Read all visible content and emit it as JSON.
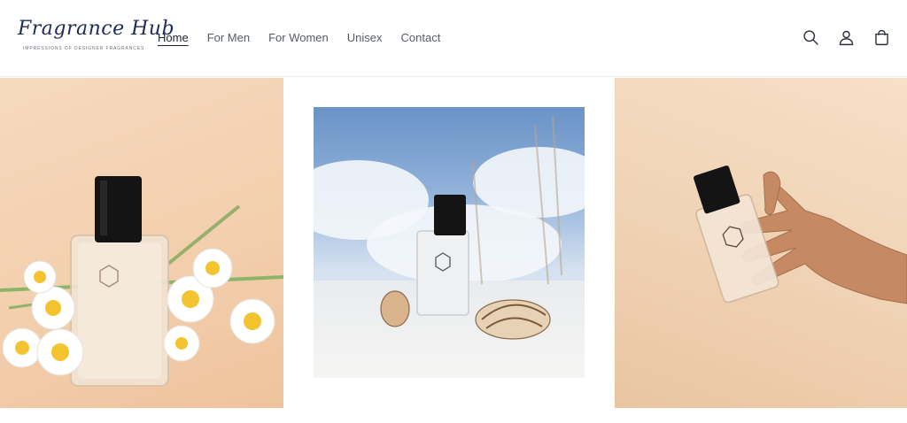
{
  "brand": {
    "name": "Fragrance Hub",
    "tagline": "IMPRESSIONS OF DESIGNER FRAGRANCES"
  },
  "nav": {
    "items": [
      {
        "label": "Home",
        "active": true
      },
      {
        "label": "For Men",
        "active": false
      },
      {
        "label": "For Women",
        "active": false
      },
      {
        "label": "Unisex",
        "active": false
      },
      {
        "label": "Contact",
        "active": false
      }
    ]
  },
  "header_icons": [
    "search-icon",
    "account-icon",
    "cart-icon"
  ],
  "gallery": {
    "images": [
      {
        "subject": "perfume-bottle-with-daisies",
        "alt": ""
      },
      {
        "subject": "perfume-bottle-with-seashells-and-sky",
        "alt": ""
      },
      {
        "subject": "hand-holding-perfume-bottle",
        "alt": ""
      }
    ]
  },
  "colors": {
    "brand_text": "#1e2c55",
    "nav_text": "#565b66",
    "peach_background": "#f3cfae",
    "bottle_cap": "#141414"
  }
}
